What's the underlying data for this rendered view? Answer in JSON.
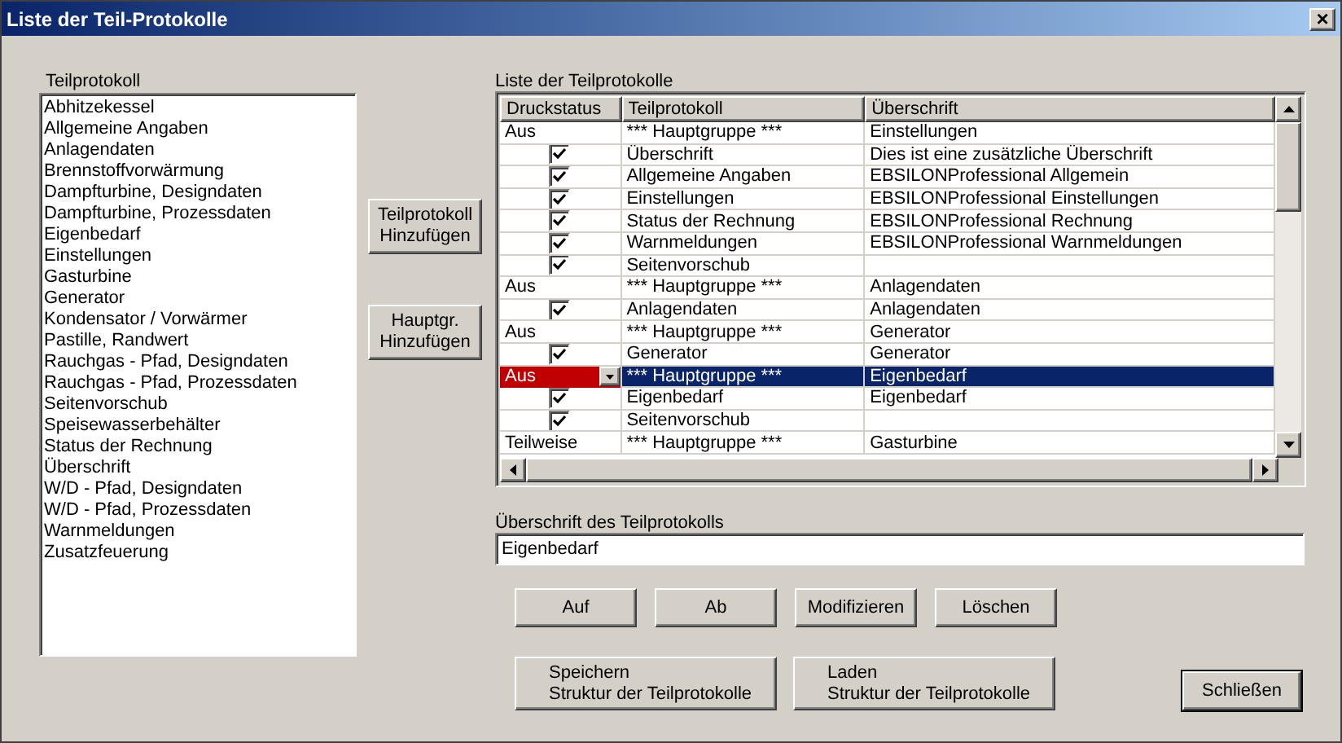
{
  "window": {
    "title": "Liste der Teil-Protokolle",
    "close": "×"
  },
  "left": {
    "label": "Teilprotokoll",
    "items": [
      "Abhitzekessel",
      "Allgemeine Angaben",
      "Anlagendaten",
      "Brennstoffvorwärmung",
      "Dampfturbine, Designdaten",
      "Dampfturbine, Prozessdaten",
      "Eigenbedarf",
      "Einstellungen",
      "Gasturbine",
      "Generator",
      "Kondensator / Vorwärmer",
      "Pastille, Randwert",
      "Rauchgas - Pfad, Designdaten",
      "Rauchgas - Pfad, Prozessdaten",
      "Seitenvorschub",
      "Speisewasserbehälter",
      "Status der Rechnung",
      "Überschrift",
      "W/D - Pfad, Designdaten",
      "W/D - Pfad, Prozessdaten",
      "Warnmeldungen",
      "Zusatzfeuerung"
    ]
  },
  "add_buttons": [
    [
      "Teilprotokoll",
      "Hinzufügen"
    ],
    [
      "Hauptgr.",
      "Hinzufügen"
    ]
  ],
  "table": {
    "label": "Liste der Teilprotokolle",
    "columns": [
      "Druckstatus",
      "Teilprotokoll",
      "Überschrift"
    ],
    "rows": [
      {
        "kind": "group",
        "status": "Aus",
        "name": "*** Hauptgruppe ***",
        "heading": "Einstellungen",
        "selected": false
      },
      {
        "kind": "item",
        "checked": true,
        "name": "Überschrift",
        "heading": "Dies ist eine zusätzliche Überschrift",
        "selected": false
      },
      {
        "kind": "item",
        "checked": true,
        "name": "Allgemeine Angaben",
        "heading": "EBSILONProfessional Allgemein",
        "selected": false
      },
      {
        "kind": "item",
        "checked": true,
        "name": "Einstellungen",
        "heading": "EBSILONProfessional Einstellungen",
        "selected": false
      },
      {
        "kind": "item",
        "checked": true,
        "name": "Status der Rechnung",
        "heading": "EBSILONProfessional Rechnung",
        "selected": false
      },
      {
        "kind": "item",
        "checked": true,
        "name": "Warnmeldungen",
        "heading": "EBSILONProfessional Warnmeldungen",
        "selected": false
      },
      {
        "kind": "item",
        "checked": true,
        "name": "Seitenvorschub",
        "selected": false
      },
      {
        "kind": "group",
        "status": "Aus",
        "name": "*** Hauptgruppe ***",
        "heading": "Anlagendaten",
        "selected": false
      },
      {
        "kind": "item",
        "checked": true,
        "name": "Anlagendaten",
        "heading": "Anlagendaten",
        "selected": false
      },
      {
        "kind": "group",
        "status": "Aus",
        "name": "*** Hauptgruppe ***",
        "heading": "Generator",
        "selected": false
      },
      {
        "kind": "item",
        "checked": true,
        "name": "Generator",
        "heading": "Generator",
        "selected": false
      },
      {
        "kind": "group",
        "status": "Aus",
        "name": "*** Hauptgruppe ***",
        "heading": "Eigenbedarf",
        "selected": true
      },
      {
        "kind": "item",
        "checked": true,
        "name": "Eigenbedarf",
        "heading": "Eigenbedarf",
        "selected": false
      },
      {
        "kind": "item",
        "checked": true,
        "name": "Seitenvorschub",
        "selected": false
      },
      {
        "kind": "group",
        "status": "Teilweise",
        "name": "*** Hauptgruppe ***",
        "heading": "Gasturbine",
        "selected": false
      }
    ]
  },
  "heading_field": {
    "label": "Überschrift des Teilprotokolls",
    "value": "Eigenbedarf"
  },
  "action_buttons": [
    "Auf",
    "Ab",
    "Modifizieren",
    "Löschen"
  ],
  "file_buttons": [
    [
      "Speichern",
      "Struktur der Teilprotokolle"
    ],
    [
      "Laden",
      "Struktur der Teilprotokolle"
    ]
  ],
  "close_button": "Schließen"
}
